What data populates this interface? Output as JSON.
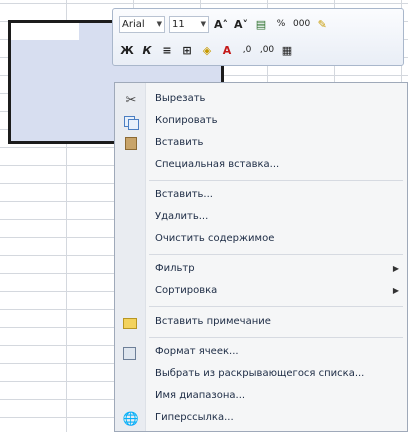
{
  "toolbar": {
    "font_name": "Arial",
    "font_size": "11",
    "grow_font": "A˄",
    "shrink_font": "A˅",
    "percent": "%",
    "thousands": "000",
    "bold": "Ж",
    "italic": "К",
    "decrease_decimal": ",00",
    "increase_decimal": ",0"
  },
  "menu": {
    "items": [
      {
        "label": "Вырезать",
        "icon": "scissors-icon"
      },
      {
        "label": "Копировать",
        "icon": "copy-icon"
      },
      {
        "label": "Вставить",
        "icon": "paste-icon"
      },
      {
        "label": "Специальная вставка..."
      },
      {
        "label": "Вставить..."
      },
      {
        "label": "Удалить..."
      },
      {
        "label": "Очистить содержимое"
      },
      {
        "label": "Фильтр",
        "submenu": true
      },
      {
        "label": "Сортировка",
        "submenu": true
      },
      {
        "label": "Вставить примечание",
        "icon": "comment-icon"
      },
      {
        "label": "Формат ячеек...",
        "icon": "format-cells-icon"
      },
      {
        "label": "Выбрать из раскрывающегося списка..."
      },
      {
        "label": "Имя диапазона..."
      },
      {
        "label": "Гиперссылка...",
        "icon": "hyperlink-icon"
      }
    ]
  }
}
